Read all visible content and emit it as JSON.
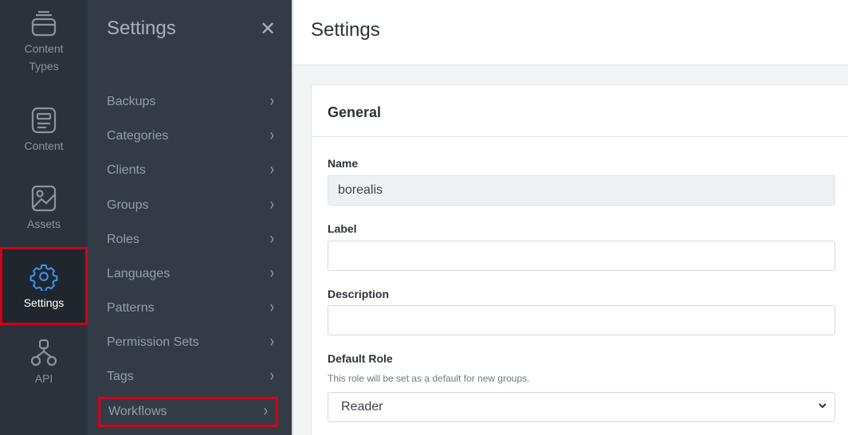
{
  "rail": {
    "items": [
      {
        "label": "Content\nTypes",
        "icon": "content-types-icon"
      },
      {
        "label": "Content",
        "icon": "content-icon"
      },
      {
        "label": "Assets",
        "icon": "assets-icon"
      },
      {
        "label": "Settings",
        "icon": "gear-icon",
        "active": true
      },
      {
        "label": "API",
        "icon": "api-icon"
      }
    ]
  },
  "panel": {
    "title": "Settings",
    "close": "✕",
    "items": [
      {
        "label": "Backups"
      },
      {
        "label": "Categories"
      },
      {
        "label": "Clients"
      },
      {
        "label": "Groups"
      },
      {
        "label": "Roles"
      },
      {
        "label": "Languages"
      },
      {
        "label": "Patterns"
      },
      {
        "label": "Permission Sets"
      },
      {
        "label": "Tags"
      },
      {
        "label": "Workflows"
      }
    ]
  },
  "main": {
    "title": "Settings",
    "card": {
      "title": "General",
      "name_label": "Name",
      "name_value": "borealis",
      "label_label": "Label",
      "label_value": "",
      "description_label": "Description",
      "description_value": "",
      "default_role_label": "Default Role",
      "default_role_hint": "This role will be set as a default for new groups.",
      "default_role_value": "Reader"
    }
  },
  "colors": {
    "rail_bg": "#2a323b",
    "panel_bg": "#333c46",
    "accent_blue": "#3d8fe8",
    "highlight_red": "#d0021b"
  }
}
